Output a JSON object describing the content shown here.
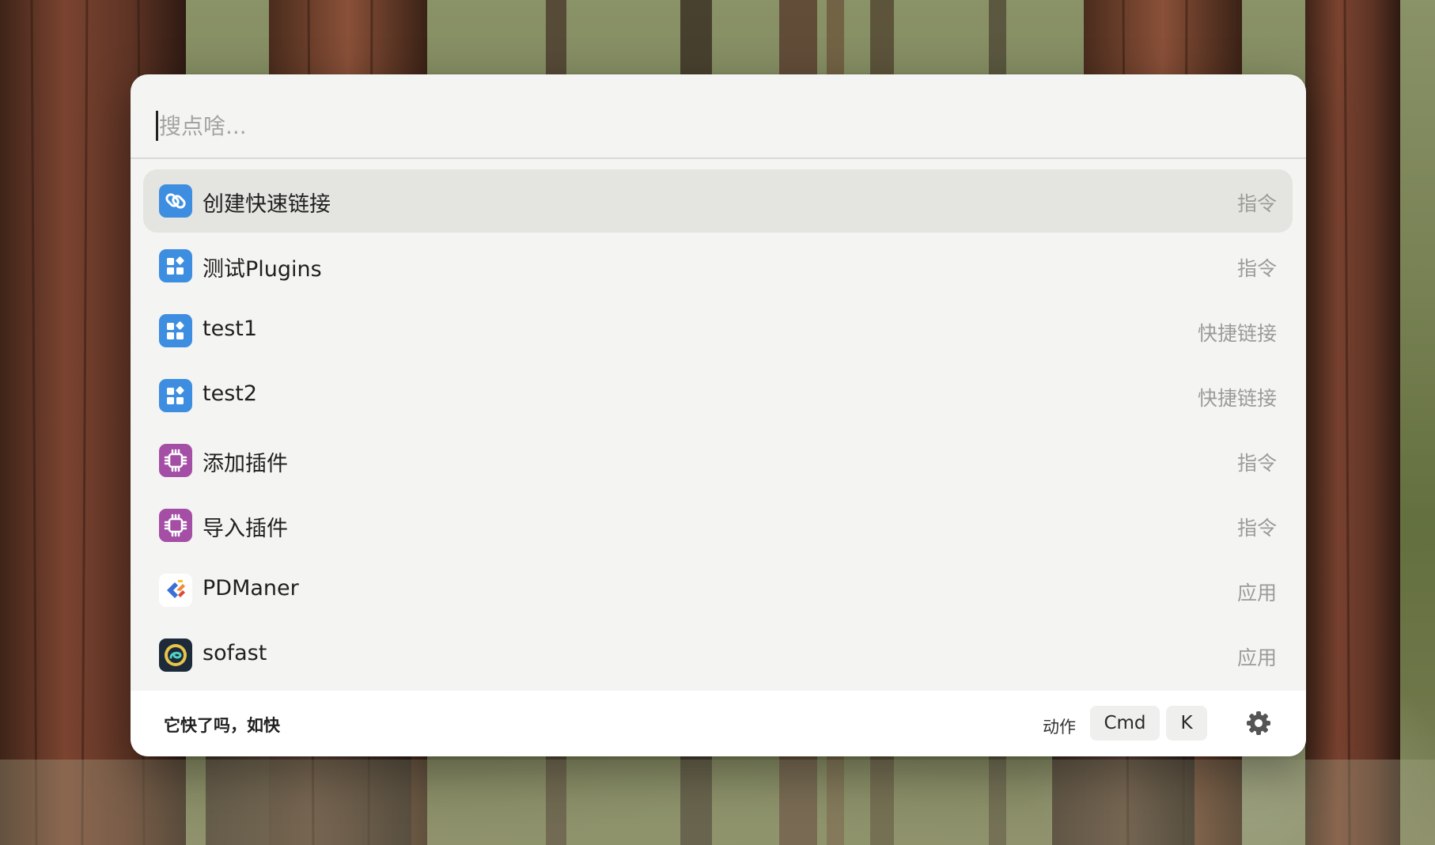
{
  "search": {
    "placeholder": "搜点啥...",
    "value": ""
  },
  "results": [
    {
      "title": "创建快速链接",
      "kind": "指令",
      "icon": "link-icon",
      "icon_color": "#3d8ee0",
      "selected": true
    },
    {
      "title": "测试Plugins",
      "kind": "指令",
      "icon": "plugin-grid-icon",
      "icon_color": "#3d8ee0",
      "selected": false
    },
    {
      "title": "test1",
      "kind": "快捷链接",
      "icon": "plugin-grid-icon",
      "icon_color": "#3d8ee0",
      "selected": false
    },
    {
      "title": "test2",
      "kind": "快捷链接",
      "icon": "plugin-grid-icon",
      "icon_color": "#3d8ee0",
      "selected": false
    },
    {
      "title": "添加插件",
      "kind": "指令",
      "icon": "chip-icon",
      "icon_color": "#a44ea6",
      "selected": false
    },
    {
      "title": "导入插件",
      "kind": "指令",
      "icon": "chip-icon",
      "icon_color": "#a44ea6",
      "selected": false
    },
    {
      "title": "PDManer",
      "kind": "应用",
      "icon": "pdmaner-app-icon",
      "icon_color": "#3a6fd8",
      "selected": false
    },
    {
      "title": "sofast",
      "kind": "应用",
      "icon": "sofast-app-icon",
      "icon_color": "#1d2a3a",
      "selected": false
    }
  ],
  "footer": {
    "brand": "它快了吗，如快",
    "action_label": "动作",
    "shortcut_keys": [
      "Cmd",
      "K"
    ],
    "settings_icon": "gear-icon"
  }
}
